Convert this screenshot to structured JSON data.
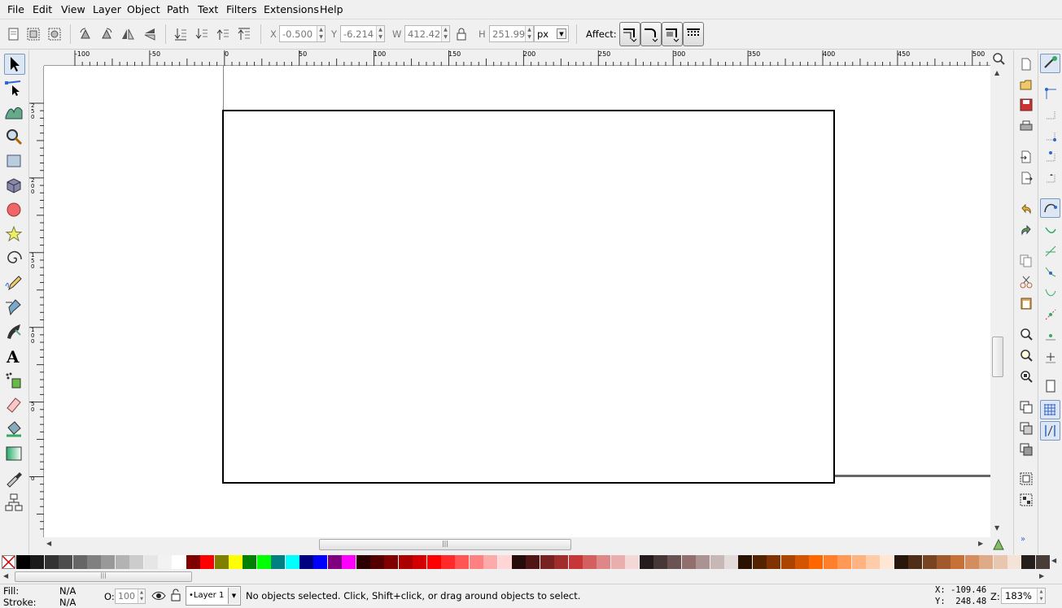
{
  "menu": [
    "File",
    "Edit",
    "View",
    "Layer",
    "Object",
    "Path",
    "Text",
    "Filters",
    "Extensions",
    "Help"
  ],
  "controls": {
    "x_label": "X",
    "x_value": "-0.500",
    "y_label": "Y",
    "y_value": "-6.214",
    "w_label": "W",
    "w_value": "412.429",
    "h_label": "H",
    "h_value": "251.999",
    "unit": "px",
    "affect_label": "Affect:"
  },
  "hruler_labels": [
    "-100",
    "-50",
    "0",
    "50",
    "100",
    "150",
    "200",
    "250",
    "300",
    "350",
    "400",
    "450",
    "500"
  ],
  "vruler_labels": [
    "250",
    "200",
    "150",
    "100",
    "50",
    "0"
  ],
  "tools": [
    "selector-icon",
    "node-icon",
    "tweak-icon",
    "zoom-icon",
    "rectangle-icon",
    "3dbox-icon",
    "ellipse-icon",
    "star-icon",
    "spiral-icon",
    "pencil-icon",
    "pen-icon",
    "calligraphy-icon",
    "text-icon",
    "spray-icon",
    "eraser-icon",
    "paint-bucket-icon",
    "gradient-icon",
    "dropper-icon",
    "connector-icon"
  ],
  "colors": {
    "palette": [
      "#000000",
      "#1a1a1a",
      "#333333",
      "#4d4d4d",
      "#666666",
      "#808080",
      "#999999",
      "#b3b3b3",
      "#cccccc",
      "#e6e6e6",
      "#f2f2f2",
      "#ffffff",
      "#800000",
      "#ff0000",
      "#808000",
      "#ffff00",
      "#008000",
      "#00ff00",
      "#008080",
      "#00ffff",
      "#000080",
      "#0000ff",
      "#800080",
      "#ff00ff",
      "#2b0000",
      "#550000",
      "#800000",
      "#aa0000",
      "#d40000",
      "#ff0000",
      "#ff2a2a",
      "#ff5555",
      "#ff8080",
      "#ffaaaa",
      "#ffd5d5",
      "#280b0b",
      "#501616",
      "#782121",
      "#a02c2c",
      "#c83737",
      "#d35f5f",
      "#de8787",
      "#e9afaf",
      "#f4d7d7",
      "#241c1c",
      "#483737",
      "#6c5353",
      "#916f6f",
      "#ac9393",
      "#c8b7b7",
      "#e3dbdb",
      "#2b1100",
      "#552200",
      "#803300",
      "#aa4400",
      "#d45500",
      "#ff6600",
      "#ff7f2a",
      "#ff9955",
      "#ffb380",
      "#ffccaa",
      "#ffe6d5",
      "#28170b",
      "#502d16",
      "#784421",
      "#a05a2c",
      "#c87137",
      "#d38d5f",
      "#deaa87",
      "#e9c6af",
      "#f4e3d7",
      "#241f1c",
      "#483e37"
    ]
  },
  "status": {
    "fill_label": "Fill:",
    "fill_value": "N/A",
    "stroke_label": "Stroke:",
    "stroke_value": "N/A",
    "opacity_label": "O:",
    "opacity_value": "100",
    "layer": "•Layer 1",
    "message": "No objects selected. Click, Shift+click, or drag around objects to select.",
    "x_coord": "X: -109.46",
    "y_coord": "Y:  248.48",
    "zoom_label": "Z:",
    "zoom_value": "183%"
  }
}
